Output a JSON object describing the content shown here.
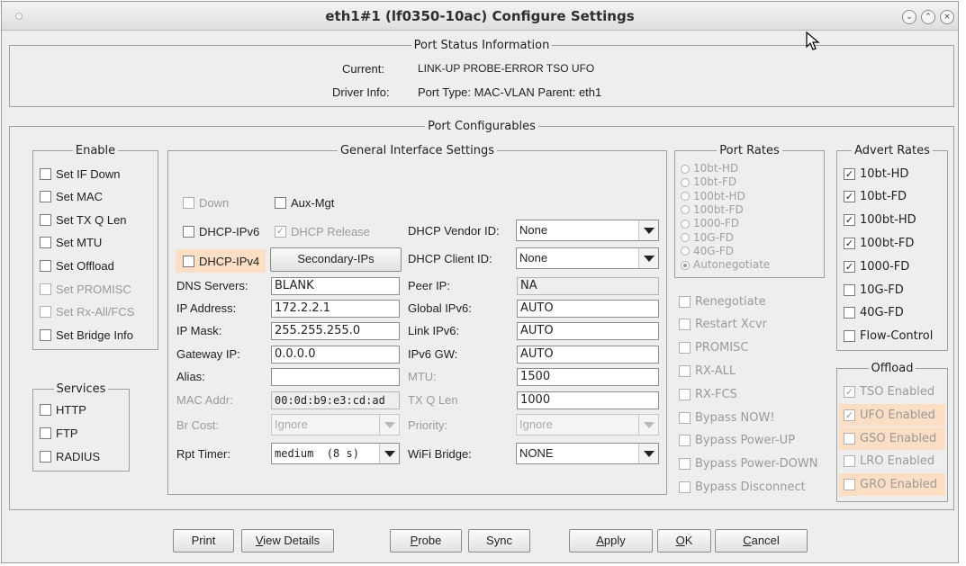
{
  "window": {
    "title": "eth1#1  (lf0350-10ac) Configure Settings",
    "controls": [
      "minimize-icon",
      "maximize-icon",
      "close-icon"
    ]
  },
  "status": {
    "legend": "Port Status Information",
    "current_label": "Current:",
    "current_value": "LINK-UP PROBE-ERROR TSO UFO",
    "driver_label": "Driver Info:",
    "driver_value": "Port Type: MAC-VLAN   Parent: eth1"
  },
  "configurables": {
    "legend": "Port Configurables"
  },
  "enable": {
    "legend": "Enable",
    "items": [
      {
        "label": "Set IF Down",
        "checked": false,
        "enabled": true
      },
      {
        "label": "Set MAC",
        "checked": false,
        "enabled": true
      },
      {
        "label": "Set TX Q Len",
        "checked": false,
        "enabled": true
      },
      {
        "label": "Set MTU",
        "checked": false,
        "enabled": true
      },
      {
        "label": "Set Offload",
        "checked": false,
        "enabled": true
      },
      {
        "label": "Set PROMISC",
        "checked": false,
        "enabled": false
      },
      {
        "label": "Set Rx-All/FCS",
        "checked": false,
        "enabled": false
      },
      {
        "label": "Set Bridge Info",
        "checked": false,
        "enabled": true
      }
    ]
  },
  "services": {
    "legend": "Services",
    "items": [
      {
        "label": "HTTP",
        "checked": false
      },
      {
        "label": "FTP",
        "checked": false
      },
      {
        "label": "RADIUS",
        "checked": false
      }
    ]
  },
  "general": {
    "legend": "General Interface Settings",
    "down_label": "Down",
    "aux_mgt_label": "Aux-Mgt",
    "dhcp_ipv6_label": "DHCP-IPv6",
    "dhcp_release_label": "DHCP Release",
    "dhcp_ipv4_label": "DHCP-IPv4",
    "secondary_ips_button": "Secondary-IPs",
    "dhcp_vendor_id_label": "DHCP Vendor ID:",
    "dhcp_vendor_id_value": "None",
    "dhcp_client_id_label": "DHCP Client ID:",
    "dhcp_client_id_value": "None",
    "dns_servers_label": "DNS Servers:",
    "dns_servers_value": "BLANK",
    "peer_ip_label": "Peer IP:",
    "peer_ip_value": "NA",
    "ip_address_label": "IP Address:",
    "ip_address_value": "172.2.2.1",
    "global_ipv6_label": "Global IPv6:",
    "global_ipv6_value": "AUTO",
    "ip_mask_label": "IP Mask:",
    "ip_mask_value": "255.255.255.0",
    "link_ipv6_label": "Link IPv6:",
    "link_ipv6_value": "AUTO",
    "gateway_ip_label": "Gateway IP:",
    "gateway_ip_value": "0.0.0.0",
    "ipv6_gw_label": "IPv6 GW:",
    "ipv6_gw_value": "AUTO",
    "alias_label": "Alias:",
    "alias_value": "",
    "mtu_label": "MTU:",
    "mtu_value": "1500",
    "mac_addr_label": "MAC Addr:",
    "mac_addr_value": "00:0d:b9:e3:cd:ad",
    "tx_q_len_label": "TX Q Len",
    "tx_q_len_value": "1000",
    "br_cost_label": "Br Cost:",
    "br_cost_value": "Ignore",
    "priority_label": "Priority:",
    "priority_value": "Ignore",
    "rpt_timer_label": "Rpt Timer:",
    "rpt_timer_value": "medium  (8 s)",
    "wifi_bridge_label": "WiFi Bridge:",
    "wifi_bridge_value": "NONE"
  },
  "port_rates": {
    "legend": "Port Rates",
    "options": [
      "10bt-HD",
      "10bt-FD",
      "100bt-HD",
      "100bt-FD",
      "1000-FD",
      "10G-FD",
      "40G-FD",
      "Autonegotiate"
    ],
    "selected": "Autonegotiate"
  },
  "port_options": [
    {
      "label": "Renegotiate",
      "checked": false
    },
    {
      "label": "Restart Xcvr",
      "checked": false
    },
    {
      "label": "PROMISC",
      "checked": false
    },
    {
      "label": "RX-ALL",
      "checked": false
    },
    {
      "label": "RX-FCS",
      "checked": false
    },
    {
      "label": "Bypass NOW!",
      "checked": false
    },
    {
      "label": "Bypass Power-UP",
      "checked": false
    },
    {
      "label": "Bypass Power-DOWN",
      "checked": false
    },
    {
      "label": "Bypass Disconnect",
      "checked": false
    }
  ],
  "advert_rates": {
    "legend": "Advert Rates",
    "items": [
      {
        "label": "10bt-HD",
        "checked": true
      },
      {
        "label": "10bt-FD",
        "checked": true
      },
      {
        "label": "100bt-HD",
        "checked": true
      },
      {
        "label": "100bt-FD",
        "checked": true
      },
      {
        "label": "1000-FD",
        "checked": true
      },
      {
        "label": "10G-FD",
        "checked": false
      },
      {
        "label": "40G-FD",
        "checked": false
      },
      {
        "label": "Flow-Control",
        "checked": false
      }
    ]
  },
  "offload": {
    "legend": "Offload",
    "items": [
      {
        "label": "TSO Enabled",
        "checked": true,
        "highlight": false
      },
      {
        "label": "UFO Enabled",
        "checked": true,
        "highlight": true
      },
      {
        "label": "GSO Enabled",
        "checked": false,
        "highlight": true
      },
      {
        "label": "LRO Enabled",
        "checked": false,
        "highlight": false
      },
      {
        "label": "GRO Enabled",
        "checked": false,
        "highlight": true
      }
    ]
  },
  "buttons": {
    "print": "Print",
    "view_details_mnemonic": "V",
    "view_details_rest": "iew Details",
    "probe_mnemonic": "P",
    "probe_rest": "robe",
    "sync": "Sync",
    "apply_mnemonic": "A",
    "apply_rest": "pply",
    "ok_mnemonic": "O",
    "ok_rest": "K",
    "cancel_mnemonic": "C",
    "cancel_rest": "ancel"
  },
  "colors": {
    "highlight": "#fbdec4",
    "window_bg": "#eeeeee"
  }
}
